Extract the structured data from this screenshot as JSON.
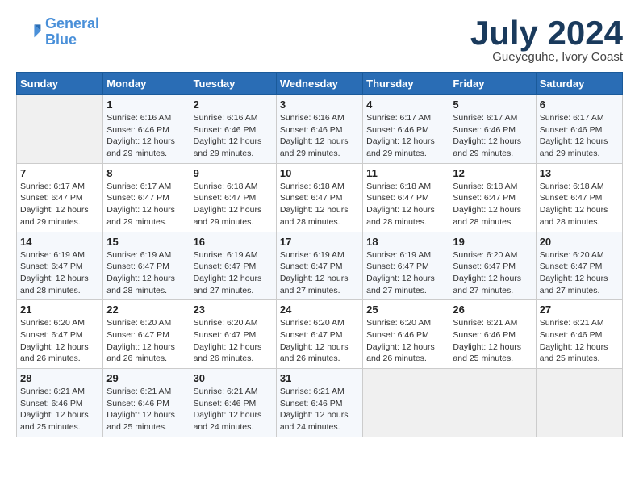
{
  "header": {
    "logo_line1": "General",
    "logo_line2": "Blue",
    "month": "July 2024",
    "location": "Gueyeguhe, Ivory Coast"
  },
  "weekdays": [
    "Sunday",
    "Monday",
    "Tuesday",
    "Wednesday",
    "Thursday",
    "Friday",
    "Saturday"
  ],
  "weeks": [
    [
      {
        "day": "",
        "empty": true
      },
      {
        "day": "1",
        "sunrise": "6:16 AM",
        "sunset": "6:46 PM",
        "daylight": "12 hours and 29 minutes."
      },
      {
        "day": "2",
        "sunrise": "6:16 AM",
        "sunset": "6:46 PM",
        "daylight": "12 hours and 29 minutes."
      },
      {
        "day": "3",
        "sunrise": "6:16 AM",
        "sunset": "6:46 PM",
        "daylight": "12 hours and 29 minutes."
      },
      {
        "day": "4",
        "sunrise": "6:17 AM",
        "sunset": "6:46 PM",
        "daylight": "12 hours and 29 minutes."
      },
      {
        "day": "5",
        "sunrise": "6:17 AM",
        "sunset": "6:46 PM",
        "daylight": "12 hours and 29 minutes."
      },
      {
        "day": "6",
        "sunrise": "6:17 AM",
        "sunset": "6:46 PM",
        "daylight": "12 hours and 29 minutes."
      }
    ],
    [
      {
        "day": "7",
        "sunrise": "6:17 AM",
        "sunset": "6:47 PM",
        "daylight": "12 hours and 29 minutes."
      },
      {
        "day": "8",
        "sunrise": "6:17 AM",
        "sunset": "6:47 PM",
        "daylight": "12 hours and 29 minutes."
      },
      {
        "day": "9",
        "sunrise": "6:18 AM",
        "sunset": "6:47 PM",
        "daylight": "12 hours and 29 minutes."
      },
      {
        "day": "10",
        "sunrise": "6:18 AM",
        "sunset": "6:47 PM",
        "daylight": "12 hours and 28 minutes."
      },
      {
        "day": "11",
        "sunrise": "6:18 AM",
        "sunset": "6:47 PM",
        "daylight": "12 hours and 28 minutes."
      },
      {
        "day": "12",
        "sunrise": "6:18 AM",
        "sunset": "6:47 PM",
        "daylight": "12 hours and 28 minutes."
      },
      {
        "day": "13",
        "sunrise": "6:18 AM",
        "sunset": "6:47 PM",
        "daylight": "12 hours and 28 minutes."
      }
    ],
    [
      {
        "day": "14",
        "sunrise": "6:19 AM",
        "sunset": "6:47 PM",
        "daylight": "12 hours and 28 minutes."
      },
      {
        "day": "15",
        "sunrise": "6:19 AM",
        "sunset": "6:47 PM",
        "daylight": "12 hours and 28 minutes."
      },
      {
        "day": "16",
        "sunrise": "6:19 AM",
        "sunset": "6:47 PM",
        "daylight": "12 hours and 27 minutes."
      },
      {
        "day": "17",
        "sunrise": "6:19 AM",
        "sunset": "6:47 PM",
        "daylight": "12 hours and 27 minutes."
      },
      {
        "day": "18",
        "sunrise": "6:19 AM",
        "sunset": "6:47 PM",
        "daylight": "12 hours and 27 minutes."
      },
      {
        "day": "19",
        "sunrise": "6:20 AM",
        "sunset": "6:47 PM",
        "daylight": "12 hours and 27 minutes."
      },
      {
        "day": "20",
        "sunrise": "6:20 AM",
        "sunset": "6:47 PM",
        "daylight": "12 hours and 27 minutes."
      }
    ],
    [
      {
        "day": "21",
        "sunrise": "6:20 AM",
        "sunset": "6:47 PM",
        "daylight": "12 hours and 26 minutes."
      },
      {
        "day": "22",
        "sunrise": "6:20 AM",
        "sunset": "6:47 PM",
        "daylight": "12 hours and 26 minutes."
      },
      {
        "day": "23",
        "sunrise": "6:20 AM",
        "sunset": "6:47 PM",
        "daylight": "12 hours and 26 minutes."
      },
      {
        "day": "24",
        "sunrise": "6:20 AM",
        "sunset": "6:47 PM",
        "daylight": "12 hours and 26 minutes."
      },
      {
        "day": "25",
        "sunrise": "6:20 AM",
        "sunset": "6:46 PM",
        "daylight": "12 hours and 26 minutes."
      },
      {
        "day": "26",
        "sunrise": "6:21 AM",
        "sunset": "6:46 PM",
        "daylight": "12 hours and 25 minutes."
      },
      {
        "day": "27",
        "sunrise": "6:21 AM",
        "sunset": "6:46 PM",
        "daylight": "12 hours and 25 minutes."
      }
    ],
    [
      {
        "day": "28",
        "sunrise": "6:21 AM",
        "sunset": "6:46 PM",
        "daylight": "12 hours and 25 minutes."
      },
      {
        "day": "29",
        "sunrise": "6:21 AM",
        "sunset": "6:46 PM",
        "daylight": "12 hours and 25 minutes."
      },
      {
        "day": "30",
        "sunrise": "6:21 AM",
        "sunset": "6:46 PM",
        "daylight": "12 hours and 24 minutes."
      },
      {
        "day": "31",
        "sunrise": "6:21 AM",
        "sunset": "6:46 PM",
        "daylight": "12 hours and 24 minutes."
      },
      {
        "day": "",
        "empty": true
      },
      {
        "day": "",
        "empty": true
      },
      {
        "day": "",
        "empty": true
      }
    ]
  ],
  "labels": {
    "sunrise": "Sunrise:",
    "sunset": "Sunset:",
    "daylight": "Daylight:"
  }
}
